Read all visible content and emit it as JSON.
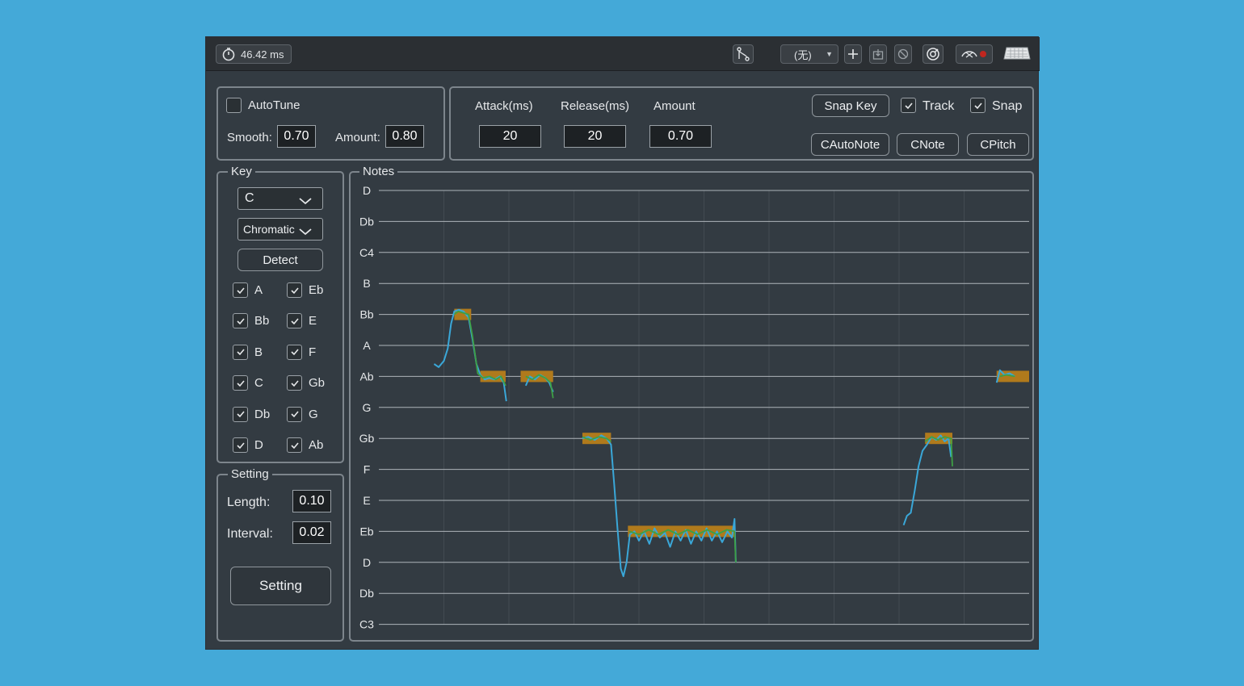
{
  "colors": {
    "background": "#44a9d8",
    "window": "#333b42",
    "pitch_line": "#3aa7d8",
    "corrected_line": "#3ea045",
    "note_block": "#b07a1c"
  },
  "toolbar": {
    "latency_icon": "stopwatch-icon",
    "latency": "46.42 ms",
    "preset": "(无)",
    "icons": [
      "route-icon",
      "plus-icon",
      "import-icon",
      "bypass-icon",
      "target-icon",
      "midi-record-icon",
      "keyboard-icon"
    ]
  },
  "autotune": {
    "label": "AutoTune",
    "checked": false,
    "smooth_label": "Smooth:",
    "smooth": "0.70",
    "amount_label": "Amount:",
    "amount": "0.80"
  },
  "envelope": {
    "attack_label": "Attack(ms)",
    "attack": "20",
    "release_label": "Release(ms)",
    "release": "20",
    "amount_label": "Amount",
    "amount": "0.70"
  },
  "actions": {
    "snap_key": "Snap Key",
    "track_label": "Track",
    "track_checked": true,
    "snap_label": "Snap",
    "snap_checked": true,
    "cautonote": "CAutoNote",
    "cnote": "CNote",
    "cpitch": "CPitch"
  },
  "key_panel": {
    "title": "Key",
    "key": "C",
    "scale": "Chromatic",
    "detect": "Detect",
    "notes": [
      {
        "name": "A",
        "checked": true
      },
      {
        "name": "Eb",
        "checked": true
      },
      {
        "name": "Bb",
        "checked": true
      },
      {
        "name": "E",
        "checked": true
      },
      {
        "name": "B",
        "checked": true
      },
      {
        "name": "F",
        "checked": true
      },
      {
        "name": "C",
        "checked": true
      },
      {
        "name": "Gb",
        "checked": true
      },
      {
        "name": "Db",
        "checked": true
      },
      {
        "name": "G",
        "checked": true
      },
      {
        "name": "D",
        "checked": true
      },
      {
        "name": "Ab",
        "checked": true
      }
    ]
  },
  "setting_panel": {
    "title": "Setting",
    "length_label": "Length:",
    "length": "0.10",
    "interval_label": "Interval:",
    "interval": "0.02",
    "button": "Setting"
  },
  "notes_panel": {
    "title": "Notes",
    "pitch_labels": [
      "D",
      "Db",
      "C4",
      "B",
      "Bb",
      "A",
      "Ab",
      "G",
      "Gb",
      "F",
      "E",
      "Eb",
      "D",
      "Db",
      "C3"
    ],
    "time_divisions": 10,
    "note_blocks": [
      {
        "start": 0.116,
        "end": 0.142,
        "pitch": 4
      },
      {
        "start": 0.156,
        "end": 0.195,
        "pitch": 6
      },
      {
        "start": 0.218,
        "end": 0.268,
        "pitch": 6
      },
      {
        "start": 0.313,
        "end": 0.357,
        "pitch": 8
      },
      {
        "start": 0.383,
        "end": 0.547,
        "pitch": 11
      },
      {
        "start": 0.84,
        "end": 0.882,
        "pitch": 8
      },
      {
        "start": 0.95,
        "end": 1.0,
        "pitch": 6
      }
    ],
    "pitch_segments": [
      [
        [
          0.085,
          5.6
        ],
        [
          0.092,
          5.7
        ],
        [
          0.1,
          5.5
        ],
        [
          0.106,
          5.1
        ],
        [
          0.111,
          4.3
        ],
        [
          0.116,
          3.9
        ],
        [
          0.123,
          3.85
        ],
        [
          0.13,
          3.9
        ],
        [
          0.138,
          4.1
        ],
        [
          0.144,
          4.8
        ],
        [
          0.15,
          5.6
        ],
        [
          0.156,
          5.95
        ],
        [
          0.163,
          6.1
        ],
        [
          0.17,
          6.05
        ],
        [
          0.178,
          6.1
        ],
        [
          0.186,
          6.0
        ],
        [
          0.192,
          6.2
        ],
        [
          0.196,
          6.8
        ]
      ],
      [
        [
          0.226,
          6.3
        ],
        [
          0.232,
          6.0
        ],
        [
          0.24,
          6.1
        ],
        [
          0.248,
          5.95
        ],
        [
          0.256,
          6.05
        ],
        [
          0.262,
          6.2
        ],
        [
          0.268,
          6.5
        ]
      ],
      [
        [
          0.313,
          8.0
        ],
        [
          0.322,
          7.95
        ],
        [
          0.332,
          8.05
        ],
        [
          0.342,
          7.9
        ],
        [
          0.35,
          8.0
        ],
        [
          0.357,
          8.2
        ],
        [
          0.362,
          9.5
        ],
        [
          0.367,
          10.9
        ],
        [
          0.372,
          12.2
        ],
        [
          0.376,
          12.45
        ],
        [
          0.381,
          12.0
        ],
        [
          0.386,
          11.1
        ],
        [
          0.393,
          11.0
        ],
        [
          0.4,
          11.3
        ],
        [
          0.408,
          11.0
        ],
        [
          0.416,
          11.4
        ],
        [
          0.424,
          10.9
        ],
        [
          0.432,
          11.2
        ],
        [
          0.44,
          11.05
        ],
        [
          0.448,
          11.5
        ],
        [
          0.456,
          11.0
        ],
        [
          0.464,
          11.3
        ],
        [
          0.472,
          10.95
        ],
        [
          0.48,
          11.4
        ],
        [
          0.488,
          11.0
        ],
        [
          0.496,
          11.3
        ],
        [
          0.504,
          10.9
        ],
        [
          0.512,
          11.3
        ],
        [
          0.52,
          11.0
        ],
        [
          0.528,
          11.35
        ],
        [
          0.536,
          11.0
        ],
        [
          0.543,
          11.2
        ],
        [
          0.547,
          10.6
        ],
        [
          0.549,
          12.0
        ]
      ],
      [
        [
          0.807,
          10.8
        ],
        [
          0.812,
          10.5
        ],
        [
          0.818,
          10.4
        ],
        [
          0.824,
          9.7
        ],
        [
          0.83,
          8.9
        ],
        [
          0.836,
          8.4
        ],
        [
          0.843,
          8.2
        ],
        [
          0.85,
          7.95
        ],
        [
          0.857,
          8.05
        ],
        [
          0.864,
          7.9
        ],
        [
          0.87,
          8.1
        ],
        [
          0.876,
          8.0
        ],
        [
          0.88,
          8.6
        ]
      ],
      [
        [
          0.95,
          6.2
        ],
        [
          0.955,
          5.8
        ],
        [
          0.962,
          5.95
        ],
        [
          0.97,
          5.9
        ],
        [
          0.978,
          6.0
        ]
      ]
    ],
    "corrected_segments": [
      [
        [
          0.116,
          4.0
        ],
        [
          0.122,
          3.9
        ],
        [
          0.13,
          3.95
        ],
        [
          0.138,
          4.0
        ],
        [
          0.144,
          4.7
        ],
        [
          0.152,
          5.9
        ],
        [
          0.16,
          6.05
        ],
        [
          0.17,
          6.0
        ],
        [
          0.18,
          6.1
        ],
        [
          0.188,
          6.0
        ],
        [
          0.195,
          6.3
        ]
      ],
      [
        [
          0.226,
          6.0
        ],
        [
          0.236,
          6.1
        ],
        [
          0.246,
          5.95
        ],
        [
          0.256,
          6.05
        ],
        [
          0.264,
          6.2
        ],
        [
          0.268,
          6.7
        ]
      ],
      [
        [
          0.313,
          7.95
        ],
        [
          0.325,
          8.05
        ],
        [
          0.338,
          7.95
        ],
        [
          0.35,
          8.0
        ],
        [
          0.357,
          8.1
        ]
      ],
      [
        [
          0.385,
          11.0
        ],
        [
          0.4,
          11.1
        ],
        [
          0.415,
          10.95
        ],
        [
          0.43,
          11.1
        ],
        [
          0.445,
          10.95
        ],
        [
          0.46,
          11.1
        ],
        [
          0.475,
          10.95
        ],
        [
          0.49,
          11.1
        ],
        [
          0.505,
          10.95
        ],
        [
          0.52,
          11.1
        ],
        [
          0.535,
          10.95
        ],
        [
          0.547,
          11.0
        ],
        [
          0.549,
          12.0
        ]
      ],
      [
        [
          0.84,
          8.1
        ],
        [
          0.85,
          7.95
        ],
        [
          0.86,
          8.05
        ],
        [
          0.87,
          7.95
        ],
        [
          0.88,
          8.0
        ],
        [
          0.882,
          8.9
        ]
      ],
      [
        [
          0.955,
          6.0
        ],
        [
          0.965,
          5.95
        ],
        [
          0.978,
          6.0
        ]
      ]
    ]
  }
}
